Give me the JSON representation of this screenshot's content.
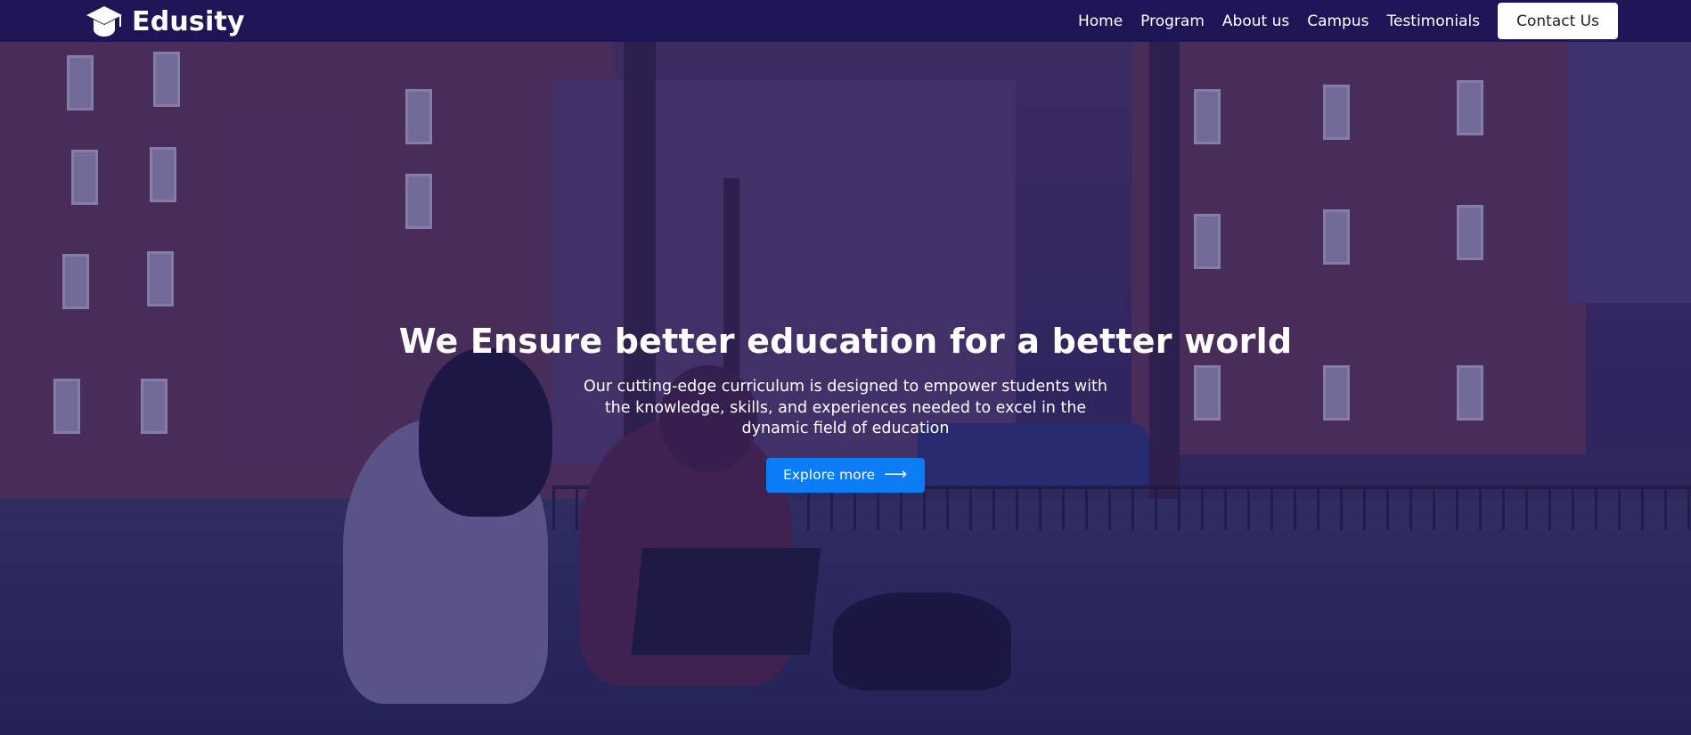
{
  "brand": {
    "name": "Edusity",
    "icon": "graduation-cap-icon"
  },
  "nav": {
    "items": [
      {
        "label": "Home"
      },
      {
        "label": "Program"
      },
      {
        "label": "About us"
      },
      {
        "label": "Campus"
      },
      {
        "label": "Testimonials"
      }
    ],
    "contact_label": "Contact Us"
  },
  "hero": {
    "title": "We Ensure better education for a better world",
    "subtitle": "Our cutting-edge curriculum is designed to empower students with the knowledge, skills, and experiences needed to excel in the dynamic field of education",
    "cta_label": "Explore more",
    "cta_icon": "arrow-right-icon"
  },
  "colors": {
    "navbar": "#1e1556",
    "cta": "#0a7cf6",
    "overlay": "#201860"
  }
}
